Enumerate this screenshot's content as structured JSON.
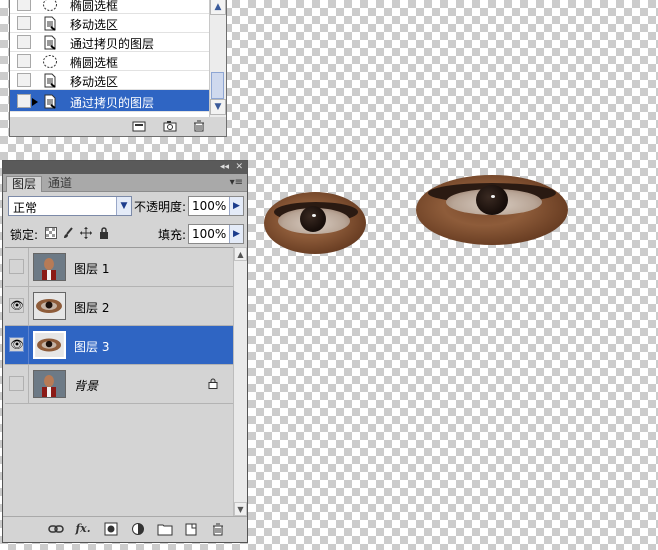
{
  "history": {
    "items": [
      {
        "label": "椭圆选框",
        "icon": "ellipse-marquee-icon"
      },
      {
        "label": "移动选区",
        "icon": "document-icon"
      },
      {
        "label": "通过拷贝的图层",
        "icon": "document-icon"
      },
      {
        "label": "椭圆选框",
        "icon": "ellipse-marquee-icon"
      },
      {
        "label": "移动选区",
        "icon": "document-icon"
      },
      {
        "label": "通过拷贝的图层",
        "icon": "document-icon",
        "active": true
      }
    ],
    "footer_icons": [
      "new-document-from-state-icon",
      "camera-snapshot-icon",
      "trash-icon"
    ]
  },
  "layers_panel": {
    "tabs": [
      {
        "label": "图层",
        "active": true
      },
      {
        "label": "通道",
        "active": false
      }
    ],
    "blend_mode": "正常",
    "opacity_label": "不透明度:",
    "opacity_value": "100%",
    "lock_label": "锁定:",
    "fill_label": "填充:",
    "fill_value": "100%",
    "lock_icons": [
      "lock-transparent-icon",
      "lock-brush-icon",
      "lock-move-icon",
      "lock-all-icon"
    ],
    "layers": [
      {
        "name": "图层 1",
        "visible": false,
        "selected": false,
        "thumb": "portrait",
        "italic": false,
        "locked": false
      },
      {
        "name": "图层 2",
        "visible": true,
        "selected": false,
        "thumb": "eye",
        "italic": false,
        "locked": false
      },
      {
        "name": "图层 3",
        "visible": true,
        "selected": true,
        "thumb": "eye",
        "italic": false,
        "locked": false
      },
      {
        "name": "背景",
        "visible": false,
        "selected": false,
        "thumb": "portrait",
        "italic": true,
        "locked": true
      }
    ],
    "bottom_icons": [
      "link-layers-icon",
      "fx-icon",
      "add-mask-icon",
      "adjustment-layer-icon",
      "new-group-icon",
      "new-layer-icon",
      "delete-layer-icon"
    ]
  },
  "colors": {
    "selection": "#2f65c3",
    "panel_bg": "#d4d4d4",
    "skin": "#8e5c3a"
  }
}
